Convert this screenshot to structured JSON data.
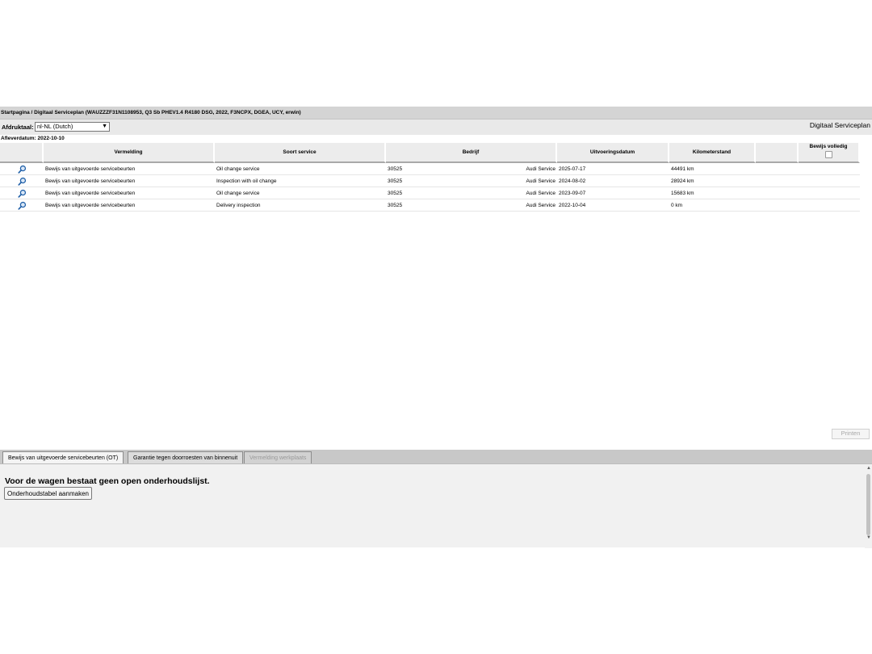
{
  "breadcrumb": "Startpagina / Digitaal Serviceplan (WAUZZZF31N1108953, Q3 Sb PHEV1.4 R4180 DSG, 2022, F3NCPX, DGEA, UCY, erwin)",
  "toolbar": {
    "printout_label": "Afdruktaal:",
    "language_selected": "nl-NL (Dutch)",
    "module_title": "Digitaal Serviceplan"
  },
  "delivery_date": {
    "label": "Afleverdatum:",
    "value": "2022-10-10"
  },
  "table": {
    "headers": {
      "entry": "Vermelding",
      "service_type": "Soort service",
      "company": "Bedrijf",
      "execution_date": "Uitvoeringsdatum",
      "mileage": "Kilometerstand",
      "proof_complete": "Bewijs volledig"
    },
    "rows": [
      {
        "entry": "Bewijs van uitgevoerde servicebeurten",
        "service_type": "Oil change service",
        "company_code": "30525",
        "company_name": "Audi Service",
        "date": "2025-07-17",
        "mileage": "44491 km"
      },
      {
        "entry": "Bewijs van uitgevoerde servicebeurten",
        "service_type": "Inspection with oil change",
        "company_code": "30525",
        "company_name": "Audi Service",
        "date": "2024-08-02",
        "mileage": "28924 km"
      },
      {
        "entry": "Bewijs van uitgevoerde servicebeurten",
        "service_type": "Oil change service",
        "company_code": "30525",
        "company_name": "Audi Service",
        "date": "2023-09-07",
        "mileage": "15683 km"
      },
      {
        "entry": "Bewijs van uitgevoerde servicebeurten",
        "service_type": "Delivery inspection",
        "company_code": "30525",
        "company_name": "Audi Service",
        "date": "2022-10-04",
        "mileage": "0 km"
      }
    ]
  },
  "print_button": "Printen",
  "tabs": [
    {
      "label": "Bewijs van uitgevoerde servicebeurten (OT)",
      "state": "active"
    },
    {
      "label": "Garantie tegen doorroesten van binnenuit",
      "state": "normal"
    },
    {
      "label": "Vermelding werkplaats",
      "state": "disabled"
    }
  ],
  "panel": {
    "message": "Voor de wagen bestaat geen open onderhoudslijst.",
    "create_button": "Onderhoudstabel aanmaken"
  },
  "colors": {
    "header_bar": "#d4d4d4",
    "toolbar": "#e9e9e9",
    "magnifier": "#1f5fa8"
  },
  "icons": {
    "row_action": "magnifier-icon",
    "select_all": "checkbox-icon"
  }
}
